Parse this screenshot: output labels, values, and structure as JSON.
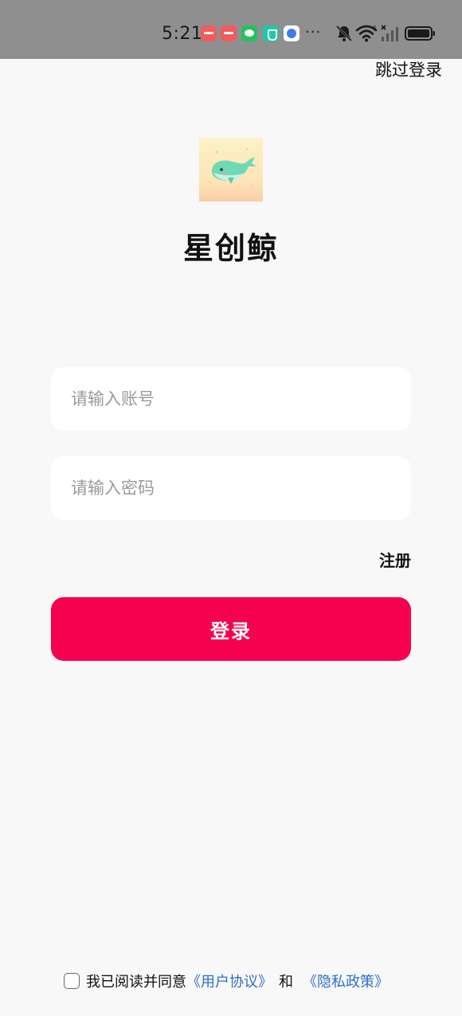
{
  "status_bar": {
    "time": "5:21",
    "more": "···",
    "icons": [
      "app-notification-icon",
      "app-notification-icon",
      "wechat-icon",
      "security-icon",
      "browser-icon",
      "bell-off-icon",
      "wifi-icon",
      "signal-icon",
      "battery-icon"
    ]
  },
  "header": {
    "skip_label": "跳过登录"
  },
  "brand": {
    "app_name": "星创鲸",
    "logo_icon": "whale-logo-icon"
  },
  "form": {
    "account_placeholder": "请输入账号",
    "account_value": "",
    "password_placeholder": "请输入密码",
    "password_value": "",
    "register_label": "注册",
    "login_label": "登录"
  },
  "agreement": {
    "checked": false,
    "prefix": "我已阅读并同意",
    "user_agreement": "《用户协议》",
    "and": "和",
    "privacy_policy": "《隐私政策》"
  },
  "colors": {
    "primary": "#f6014f",
    "link": "#2f6fc7",
    "background": "#f8f8f8",
    "status_bar": "#8f8f8f"
  }
}
